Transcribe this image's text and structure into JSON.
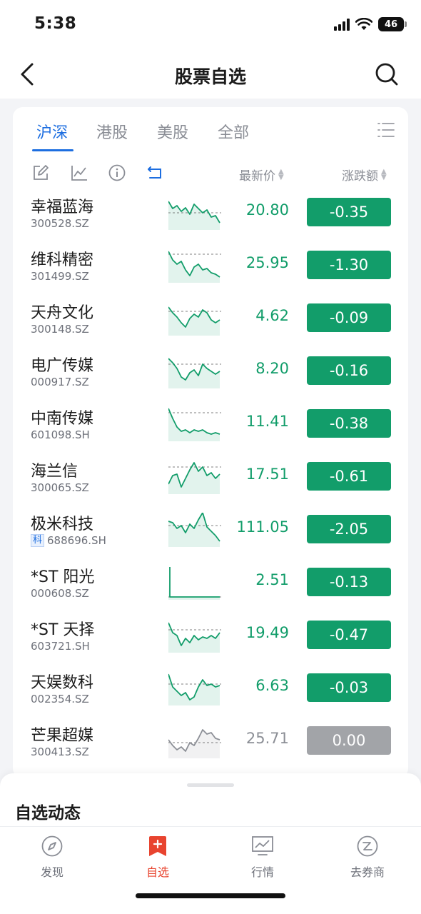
{
  "status": {
    "time": "5:38",
    "battery": "46"
  },
  "nav": {
    "title": "股票自选"
  },
  "tabs": [
    {
      "label": "沪深",
      "active": true
    },
    {
      "label": "港股",
      "active": false
    },
    {
      "label": "美股",
      "active": false
    },
    {
      "label": "全部",
      "active": false
    }
  ],
  "columns": {
    "price": "最新价",
    "change": "涨跌额"
  },
  "colors": {
    "down": "#129d6a",
    "flat": "#a2a4a8",
    "accent": "#1d6ee0",
    "tab_active": "#e8442f"
  },
  "stocks": [
    {
      "name": "幸福蓝海",
      "code": "300528.SZ",
      "price": "20.80",
      "change": "-0.35",
      "trend": "down"
    },
    {
      "name": "维科精密",
      "code": "301499.SZ",
      "price": "25.95",
      "change": "-1.30",
      "trend": "down"
    },
    {
      "name": "天舟文化",
      "code": "300148.SZ",
      "price": "4.62",
      "change": "-0.09",
      "trend": "down"
    },
    {
      "name": "电广传媒",
      "code": "000917.SZ",
      "price": "8.20",
      "change": "-0.16",
      "trend": "down"
    },
    {
      "name": "中南传媒",
      "code": "601098.SH",
      "price": "11.41",
      "change": "-0.38",
      "trend": "down"
    },
    {
      "name": "海兰信",
      "code": "300065.SZ",
      "price": "17.51",
      "change": "-0.61",
      "trend": "down"
    },
    {
      "name": "极米科技",
      "code": "688696.SH",
      "badge": "科",
      "price": "111.05",
      "change": "-2.05",
      "trend": "down"
    },
    {
      "name": "*ST 阳光",
      "code": "000608.SZ",
      "price": "2.51",
      "change": "-0.13",
      "trend": "down"
    },
    {
      "name": "*ST 天择",
      "code": "603721.SH",
      "price": "19.49",
      "change": "-0.47",
      "trend": "down"
    },
    {
      "name": "天娱数科",
      "code": "002354.SZ",
      "price": "6.63",
      "change": "-0.03",
      "trend": "down"
    },
    {
      "name": "芒果超媒",
      "code": "300413.SZ",
      "price": "25.71",
      "change": "0.00",
      "trend": "flat"
    }
  ],
  "sheet": {
    "title": "自选动态"
  },
  "tabbar": [
    {
      "label": "发现",
      "icon": "compass-icon",
      "active": false
    },
    {
      "label": "自选",
      "icon": "bookmark-plus-icon",
      "active": true
    },
    {
      "label": "行情",
      "icon": "chart-monitor-icon",
      "active": false
    },
    {
      "label": "去券商",
      "icon": "broker-icon",
      "active": false
    }
  ]
}
